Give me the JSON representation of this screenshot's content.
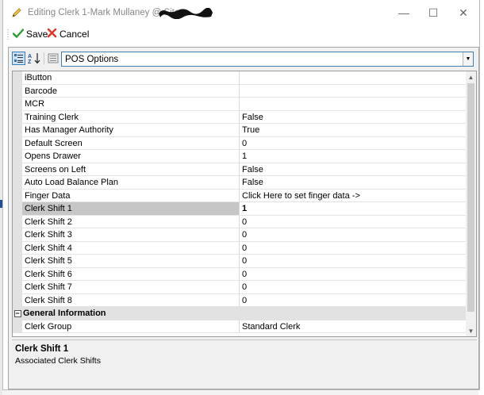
{
  "window": {
    "title": "Editing Clerk 1-Mark Mullaney @ Site",
    "controls": {
      "minimize": "—",
      "maximize": "☐",
      "close": "✕"
    }
  },
  "toolbar": {
    "save_label": "Save",
    "cancel_label": "Cancel"
  },
  "property_grid": {
    "category_dropdown": "POS Options",
    "rows": [
      {
        "name": "iButton",
        "value": ""
      },
      {
        "name": "Barcode",
        "value": ""
      },
      {
        "name": "MCR",
        "value": ""
      },
      {
        "name": "Training Clerk",
        "value": "False"
      },
      {
        "name": "Has Manager Authority",
        "value": "True"
      },
      {
        "name": "Default Screen",
        "value": "0"
      },
      {
        "name": "Opens Drawer",
        "value": "1"
      },
      {
        "name": "Screens on Left",
        "value": "False"
      },
      {
        "name": "Auto Load Balance Plan",
        "value": "False"
      },
      {
        "name": "Finger Data",
        "value": "Click Here to set finger data ->"
      },
      {
        "name": "Clerk Shift 1",
        "value": "1",
        "selected": true
      },
      {
        "name": "Clerk Shift 2",
        "value": "0"
      },
      {
        "name": "Clerk Shift 3",
        "value": "0"
      },
      {
        "name": "Clerk Shift 4",
        "value": "0"
      },
      {
        "name": "Clerk Shift 5",
        "value": "0"
      },
      {
        "name": "Clerk Shift 6",
        "value": "0"
      },
      {
        "name": "Clerk Shift 7",
        "value": "0"
      },
      {
        "name": "Clerk Shift 8",
        "value": "0"
      }
    ],
    "category": {
      "label": "General Information",
      "expander": "−"
    },
    "category_rows": [
      {
        "name": "Clerk Group",
        "value": "Standard Clerk"
      }
    ],
    "description": {
      "title": "Clerk Shift 1",
      "text": "Associated Clerk Shifts"
    }
  },
  "colors": {
    "save_icon": "#2e9a2e",
    "cancel_icon": "#d83a2a",
    "selection_border": "#3c7fb1",
    "selected_row": "#c6c6c6"
  },
  "icons": {
    "title": "pencil-icon",
    "save": "checkmark-icon",
    "cancel": "red-x-icon",
    "categorized": "categorized-view-icon",
    "alphabetical": "sort-alphabetical-icon",
    "property_pages": "property-pages-icon"
  }
}
